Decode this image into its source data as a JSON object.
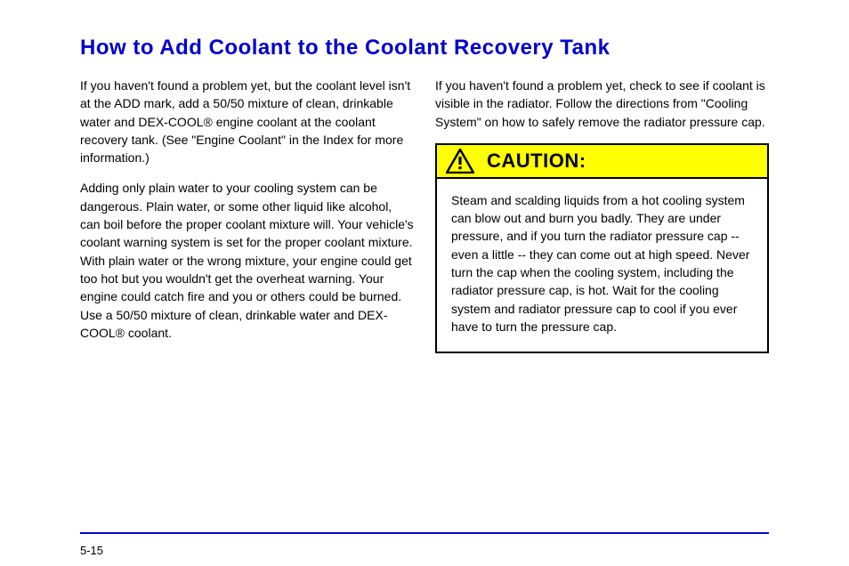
{
  "heading": "How to Add Coolant to the Coolant Recovery Tank",
  "left_column": {
    "p1": "If you haven't found a problem yet, but the coolant level isn't at the ADD mark, add a 50/50 mixture of clean, drinkable water and DEX-COOL® engine coolant at the coolant recovery tank. (See \"Engine Coolant\" in the Index for more information.)",
    "p2": "Adding only plain water to your cooling system can be dangerous. Plain water, or some other liquid like alcohol, can boil before the proper coolant mixture will. Your vehicle's coolant warning system is set for the proper coolant mixture. With plain water or the wrong mixture, your engine could get too hot but you wouldn't get the overheat warning. Your engine could catch fire and you or others could be burned. Use a 50/50 mixture of clean, drinkable water and DEX-COOL® coolant."
  },
  "right_column": {
    "intro": "If you haven't found a problem yet, check to see if coolant is visible in the radiator. Follow the directions from \"Cooling System\" on how to safely remove the radiator pressure cap.",
    "caution_label": "CAUTION:",
    "caution_body": "Steam and scalding liquids from a hot cooling system can blow out and burn you badly. They are under pressure, and if you turn the radiator pressure cap -- even a little -- they can come out at high speed. Never turn the cap when the cooling system, including the radiator pressure cap, is hot. Wait for the cooling system and radiator pressure cap to cool if you ever have to turn the pressure cap."
  },
  "page_number": "5-15"
}
